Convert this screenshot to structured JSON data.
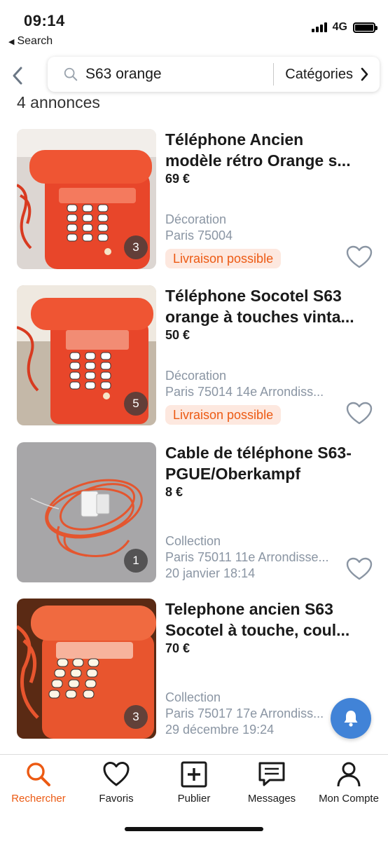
{
  "status_bar": {
    "time": "09:14",
    "back_app": "Search",
    "network": "4G"
  },
  "search": {
    "query": "S63 orange",
    "categories_label": "Catégories"
  },
  "results_count": "4 annonces",
  "listings": [
    {
      "title": "Téléphone Ancien modèle rétro Orange s...",
      "title_line1": "Téléphone Ancien",
      "title_line2": "modèle rétro Orange s...",
      "price": "69 €",
      "category": "Décoration",
      "location": "Paris 75004",
      "badge": "Livraison possible",
      "date": "",
      "photo_count": "3",
      "icon": "heart-icon"
    },
    {
      "title": "Téléphone Socotel S63 orange à touches vinta...",
      "title_line1": "Téléphone Socotel S63",
      "title_line2": "orange à touches vinta...",
      "price": "50 €",
      "category": "Décoration",
      "location": "Paris 75014 14e Arrondiss...",
      "badge": "Livraison possible",
      "date": "",
      "photo_count": "5",
      "icon": "heart-icon"
    },
    {
      "title": "Cable de téléphone S63-PGUE/Oberkampf",
      "title_line1": "Cable de téléphone S63-",
      "title_line2": "PGUE/Oberkampf",
      "price": "8 €",
      "category": "Collection",
      "location": "Paris 75011 11e Arrondisse...",
      "badge": "",
      "date": "20 janvier 18:14",
      "photo_count": "1",
      "icon": "heart-icon"
    },
    {
      "title": "Telephone ancien S63 Socotel à touche, coul...",
      "title_line1": "Telephone ancien S63",
      "title_line2": "Socotel à touche, coul...",
      "price": "70 €",
      "category": "Collection",
      "location": "Paris 75017 17e Arrondiss...",
      "badge": "",
      "date": "29 décembre 19:24",
      "photo_count": "3",
      "icon": "heart-icon"
    }
  ],
  "tabs": [
    {
      "label": "Rechercher",
      "icon": "search-icon",
      "active": true
    },
    {
      "label": "Favoris",
      "icon": "heart-icon",
      "active": false
    },
    {
      "label": "Publier",
      "icon": "plus-square-icon",
      "active": false
    },
    {
      "label": "Messages",
      "icon": "message-icon",
      "active": false
    },
    {
      "label": "Mon Compte",
      "icon": "user-icon",
      "active": false
    }
  ],
  "colors": {
    "accent": "#ec5a13",
    "badge_bg": "#fde8df",
    "meta_text": "#8a95a3",
    "fab": "#4183d7",
    "phone_orange": "#e8462a"
  }
}
